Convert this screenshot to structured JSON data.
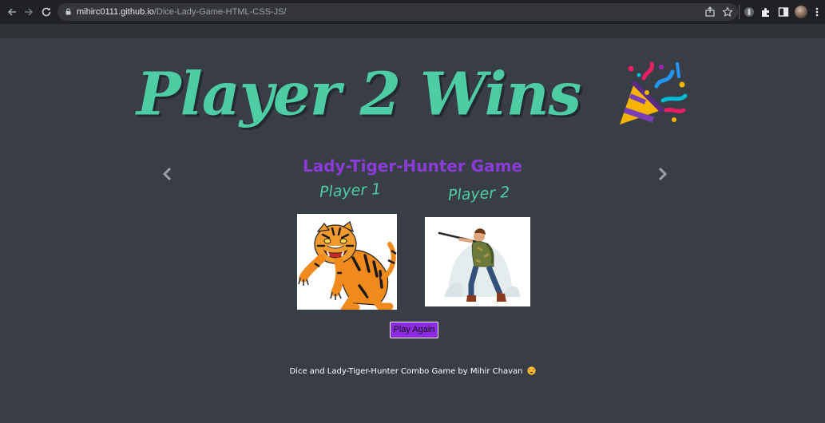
{
  "browser": {
    "url_domain": "mihirc0111.github.io",
    "url_path": "/Dice-Lady-Game-HTML-CSS-JS/",
    "icons": [
      "back-arrow-icon",
      "forward-arrow-icon",
      "reload-icon",
      "lock-icon",
      "share-icon",
      "star-icon",
      "extension-icon",
      "puzzle-icon",
      "sidebar-icon",
      "avatar"
    ]
  },
  "page": {
    "title": "Player 2 Wins",
    "title_icon": "party-popper-icon",
    "game_name": "Lady-Tiger-Hunter Game",
    "players": [
      {
        "label": "Player 1",
        "image": "tiger-image"
      },
      {
        "label": "Player 2",
        "image": "hunter-image"
      }
    ],
    "play_again_label": "Play Again",
    "footer_text": "Dice and Lady-Tiger-Hunter Combo Game by Mihir Chavan",
    "footer_icon": "star-struck-emoji-icon"
  },
  "colors": {
    "background": "#393e46",
    "accent_green": "#4ecca3",
    "accent_purple": "#8a3bd8",
    "button": "#8a2be2"
  }
}
